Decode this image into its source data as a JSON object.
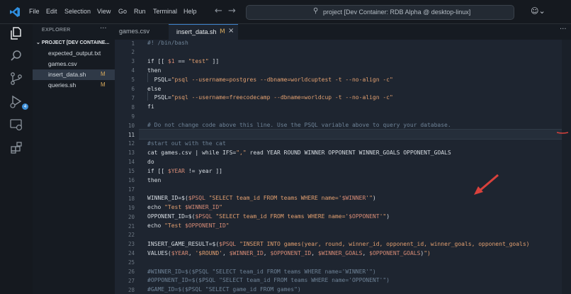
{
  "menu": [
    "File",
    "Edit",
    "Selection",
    "View",
    "Go",
    "Run",
    "Terminal",
    "Help"
  ],
  "search": {
    "text": "project [Dev Container: RDB Alpha @ desktop-linux]"
  },
  "sidebar": {
    "title": "EXPLORER",
    "more": "···",
    "project": "PROJECT [DEV CONTAINE...",
    "files": [
      {
        "name": "expected_output.txt",
        "status": ""
      },
      {
        "name": "games.csv",
        "status": ""
      },
      {
        "name": "insert_data.sh",
        "status": "M"
      },
      {
        "name": "queries.sh",
        "status": "M"
      }
    ]
  },
  "tabs": [
    {
      "label": "games.csv",
      "modified": ""
    },
    {
      "label": "insert_data.sh",
      "modified": "M"
    }
  ],
  "tabs_more": "···",
  "editor": {
    "line_numbers": [
      "1",
      "2",
      "3",
      "4",
      "5",
      "6",
      "7",
      "8",
      "9",
      "10",
      "11",
      "12",
      "13",
      "14",
      "15",
      "16",
      "17",
      "18",
      "19",
      "20",
      "21",
      "22",
      "23",
      "24",
      "25",
      "26",
      "27",
      "28"
    ],
    "current_line": "11",
    "lines": [
      "#! /bin/bash",
      "",
      "if [[ $1 == \"test\" ]]",
      "then",
      "  PSQL=\"psql --username=postgres --dbname=worldcuptest -t --no-align -c\"",
      "else",
      "  PSQL=\"psql --username=freecodecamp --dbname=worldcup -t --no-align -c\"",
      "fi",
      "",
      "# Do not change code above this line. Use the PSQL variable above to query your database.",
      "",
      "#start out with the cat",
      "cat games.csv | while IFS=\",\" read YEAR ROUND WINNER OPPONENT WINNER_GOALS OPPONENT_GOALS",
      "do",
      "if [[ $YEAR != year ]]",
      "then",
      "",
      "WINNER_ID=$($PSQL \"SELECT team_id FROM teams WHERE name='$WINNER'\")",
      "echo \"Test $WINNER_ID\"",
      "OPPONENT_ID=$($PSQL \"SELECT team_id FROM teams WHERE name='$OPPONENT'\")",
      "echo \"Test $OPPONENT_ID\"",
      "",
      "INSERT_GAME_RESULT=$($PSQL \"INSERT INTO games(year, round, winner_id, opponent_id, winner_goals, opponent_goals)",
      "VALUES($YEAR, '$ROUND', $WINNER_ID, $OPPONENT_ID, $WINNER_GOALS, $OPPONENT_GOALS)\")",
      "",
      "#WINNER_ID=$($PSQL \"SELECT team_id FROM teams WHERE name='WINNER'\")",
      "#OPPONENT_ID=$($PSQL \"SELECT team_id FROM teams WHERE name='OPPONENT'\")",
      "#GAME_ID=$($PSQL \"SELECT game_id FROM games\")"
    ]
  },
  "colors": {
    "accent": "#3c80c8",
    "modified": "#d6a85b",
    "annotation_arrow": "#d9413c"
  },
  "icons": [
    "vscode-logo",
    "explorer-icon",
    "search-icon",
    "source-control-icon",
    "run-debug-icon",
    "remote-explorer-icon",
    "extensions-icon",
    "copilot-icon"
  ]
}
